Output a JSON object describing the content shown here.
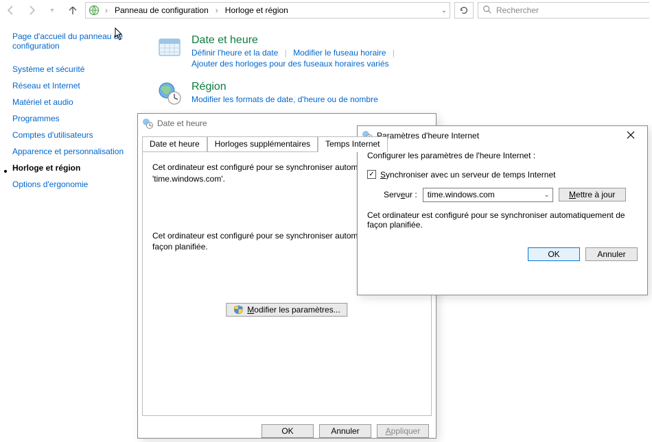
{
  "breadcrumb": {
    "item1": "Panneau de configuration",
    "item2": "Horloge et région"
  },
  "search": {
    "placeholder": "Rechercher"
  },
  "sidebar": {
    "home": "Page d'accueil du panneau de configuration",
    "items": [
      "Système et sécurité",
      "Réseau et Internet",
      "Matériel et audio",
      "Programmes",
      "Comptes d'utilisateurs",
      "Apparence et personnalisation",
      "Horloge et région",
      "Options d'ergonomie"
    ]
  },
  "categories": {
    "datetime": {
      "title": "Date et heure",
      "link1": "Définir l'heure et la date",
      "link2": "Modifier le fuseau horaire",
      "link3": "Ajouter des horloges pour des fuseaux horaires variés"
    },
    "region": {
      "title": "Région",
      "link1": "Modifier les formats de date, d'heure ou de nombre"
    }
  },
  "dlgA": {
    "title": "Date et heure",
    "tabs": {
      "t1": "Date et heure",
      "t2": "Horloges supplémentaires",
      "t3": "Temps Internet"
    },
    "body": {
      "line1": "Cet ordinateur est configuré pour se synchroniser automatiquement avec 'time.windows.com'.",
      "line2": "Cet ordinateur est configuré pour se synchroniser automatiquement de façon planifiée."
    },
    "modify": "Modifier les paramètres...",
    "ok": "OK",
    "cancel": "Annuler",
    "apply": "Appliquer"
  },
  "dlgB": {
    "title": "Paramètres d'heure Internet",
    "intro": "Configurer les paramètres de l'heure Internet :",
    "checkbox": "Synchroniser avec un serveur de temps Internet",
    "server_label": "Serveur :",
    "server_value": "time.windows.com",
    "update": "Mettre à jour",
    "note": "Cet ordinateur est configuré pour se synchroniser automatiquement de façon planifiée.",
    "ok": "OK",
    "cancel": "Annuler"
  }
}
